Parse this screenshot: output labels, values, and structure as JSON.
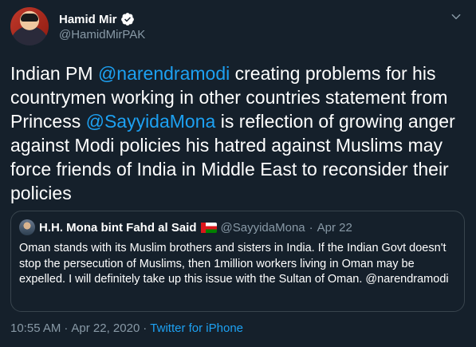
{
  "author": {
    "name": "Hamid Mir",
    "handle": "@HamidMirPAK"
  },
  "tweet": {
    "t1": "Indian PM ",
    "mention1": "@narendramodi",
    "t2": " creating problems for his countrymen working in other countries statement from Princess ",
    "mention2": "@SayyidaMona",
    "t3": " is reflection of growing anger against Modi policies his hatred against Muslims may force friends of India in Middle East to reconsider their policies"
  },
  "quote": {
    "name": "H.H. Mona bint Fahd al Said",
    "flag": "oman-flag",
    "handle": "@SayyidaMona",
    "separator": "·",
    "date": "Apr 22",
    "text": "Oman stands with its Muslim brothers and sisters in India. If the Indian Govt doesn't stop the persecution of Muslims, then 1million workers living in Oman may be expelled. I will definitely take up this issue with the Sultan of Oman. @narendramodi"
  },
  "footer": {
    "time": "10:55 AM",
    "separator1": "·",
    "date": "Apr 22, 2020",
    "separator2": "·",
    "source": "Twitter for iPhone"
  },
  "colors": {
    "background": "#15202b",
    "link": "#1da1f2",
    "secondary": "#8899a6",
    "border": "#38444d"
  }
}
